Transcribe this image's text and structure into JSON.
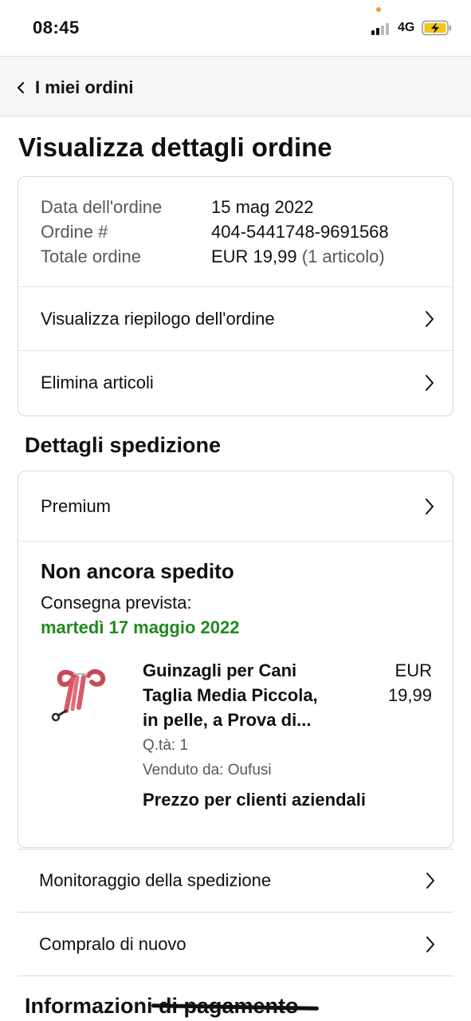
{
  "status_bar": {
    "time": "08:45",
    "network": "4G",
    "icons": [
      "signal-icon",
      "battery-charging-icon"
    ]
  },
  "nav": {
    "back_label": "I miei ordini",
    "back_icon": "chevron-left-icon"
  },
  "page_title": "Visualizza dettagli ordine",
  "order_summary": {
    "date_label": "Data dell'ordine",
    "date_value": "15 mag 2022",
    "number_label": "Ordine #",
    "number_value": "404-5441748-9691568",
    "total_label": "Totale ordine",
    "total_value": "EUR 19,99",
    "total_items": "(1 articolo)"
  },
  "order_actions": [
    {
      "label": "Visualizza riepilogo dell'ordine"
    },
    {
      "label": "Elimina articoli"
    }
  ],
  "shipping": {
    "section_title": "Dettagli spedizione",
    "service_label": "Premium",
    "status": "Non ancora spedito",
    "expected_label": "Consegna prevista:",
    "expected_date": "martedì 17 maggio 2022",
    "expected_date_color": "#1f8a1f",
    "product": {
      "title_line1": "Guinzagli per Cani",
      "title_line2": "Taglia Media Piccola,",
      "title_line3": "in pelle, a Prova di...",
      "price_currency": "EUR",
      "price_amount": "19,99",
      "quantity": "Q.tà: 1",
      "seller": "Venduto da: Oufusi",
      "business_price": "Prezzo per clienti aziendali",
      "image_icon": "red-leather-dog-leash-image"
    }
  },
  "extra_actions": [
    {
      "label": "Monitoraggio della spedizione"
    },
    {
      "label": "Compralo di nuovo"
    }
  ],
  "payment": {
    "section_title": "Informazioni di pagamento"
  },
  "colors": {
    "border": "#d5d9d9",
    "muted_text": "#565959",
    "nav_bg": "#f6f6f6",
    "battery_fill": "#f5c518"
  }
}
